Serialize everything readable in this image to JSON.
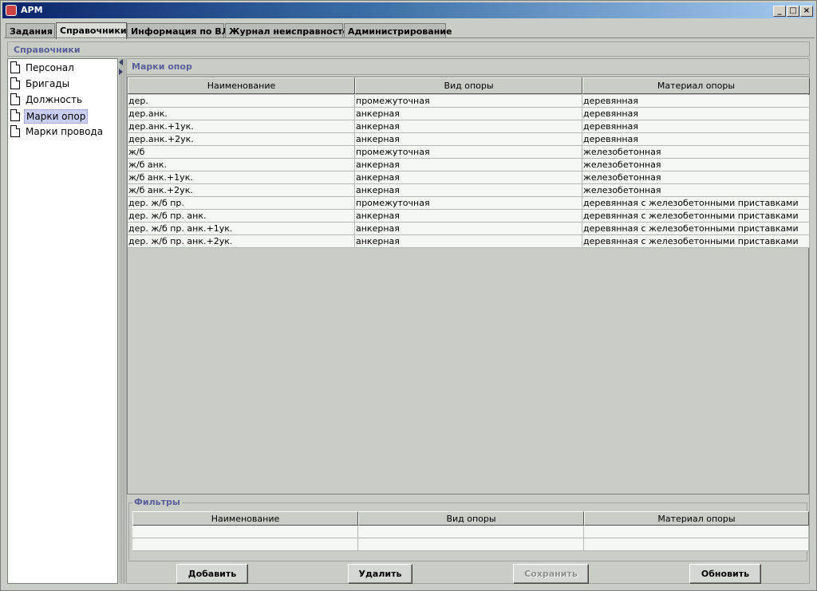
{
  "window": {
    "title": "АРМ",
    "buttons": [
      "_",
      "□",
      "×"
    ]
  },
  "tabs": [
    {
      "label": "Задания"
    },
    {
      "label": "Справочники"
    },
    {
      "label": "Информация по ВЛ"
    },
    {
      "label": "Журнал неисправностей"
    },
    {
      "label": "Администрирование"
    }
  ],
  "section": {
    "title": "Справочники"
  },
  "sidebar": {
    "items": [
      {
        "label": "Персонал"
      },
      {
        "label": "Бригады"
      },
      {
        "label": "Должность"
      },
      {
        "label": "Марки опор"
      },
      {
        "label": "Марки провода"
      }
    ]
  },
  "main": {
    "title": "Марки опор",
    "columns": [
      "Наименование",
      "Вид опоры",
      "Материал опоры"
    ],
    "rows": [
      [
        "дер.",
        "промежуточная",
        "деревянная"
      ],
      [
        "дер.анк.",
        "анкерная",
        "деревянная"
      ],
      [
        "дер.анк.+1ук.",
        "анкерная",
        "деревянная"
      ],
      [
        "дер.анк.+2ук.",
        "анкерная",
        "деревянная"
      ],
      [
        "ж/б",
        "промежуточная",
        "железобетонная"
      ],
      [
        "ж/б анк.",
        "анкерная",
        "железобетонная"
      ],
      [
        "ж/б анк.+1ук.",
        "анкерная",
        "железобетонная"
      ],
      [
        "ж/б анк.+2ук.",
        "анкерная",
        "железобетонная"
      ],
      [
        "дер. ж/б пр.",
        "промежуточная",
        "деревянная с железобетонными приставками"
      ],
      [
        "дер. ж/б пр. анк.",
        "анкерная",
        "деревянная с железобетонными приставками"
      ],
      [
        "дер. ж/б пр. анк.+1ук.",
        "анкерная",
        "деревянная с железобетонными приставками"
      ],
      [
        "дер. ж/б пр. анк.+2ук.",
        "анкерная",
        "деревянная с железобетонными приставками"
      ]
    ]
  },
  "filters": {
    "title": "Фильтры",
    "columns": [
      "Наименование",
      "Вид опоры",
      "Материал опоры"
    ]
  },
  "buttons": {
    "add": "Добавить",
    "delete": "Удалить",
    "save": "Сохранить",
    "refresh": "Обновить"
  }
}
